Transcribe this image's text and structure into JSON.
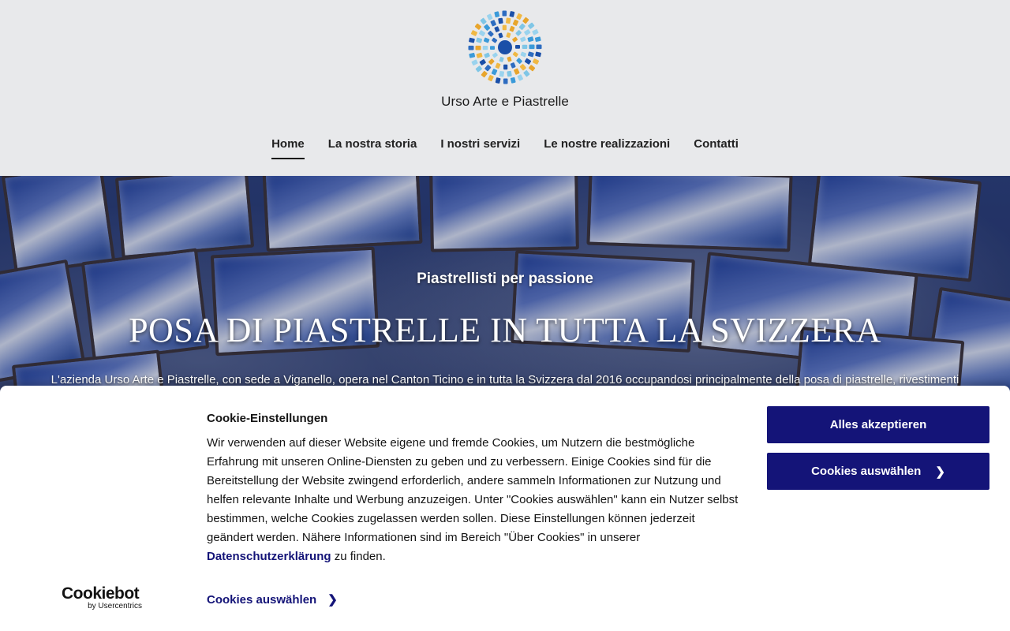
{
  "site": {
    "brand": "Urso Arte e Piastrelle"
  },
  "nav": {
    "items": [
      {
        "label": "Home",
        "active": true
      },
      {
        "label": "La nostra storia"
      },
      {
        "label": "I nostri servizi"
      },
      {
        "label": "Le nostre realizzazioni"
      },
      {
        "label": "Contatti"
      }
    ]
  },
  "hero": {
    "kicker": "Piastrellisti per passione",
    "title": "POSA DI PIASTRELLE IN TUTTA LA SVIZZERA",
    "body": "L'azienda Urso Arte e Piastrelle, con sede a Viganello, opera nel Canton Ticino e in tutta la Svizzera dal 2016 occupandosi principalmente della posa di piastrelle, rivestimenti"
  },
  "cookie_banner": {
    "logo": {
      "main": "Cookiebot",
      "sub": "by Usercentrics"
    },
    "title": "Cookie-Einstellungen",
    "text_before_link": "Wir verwenden auf dieser Website eigene und fremde Cookies, um Nutzern die bestmögliche Erfahrung mit unseren Online-Diensten zu geben und zu verbessern. Einige Cookies sind für die Bereitstellung der Website zwingend erforderlich, andere sammeln Informationen zur Nutzung und helfen relevante Inhalte und Werbung anzuzeigen. Unter \"Cookies auswählen\" kann ein Nutzer selbst bestimmen, welche Cookies zugelassen werden sollen. Diese Einstellungen können jederzeit geändert werden. Nähere Informationen sind im Bereich \"Über Cookies\" in unserer",
    "link_label": "Datenschutzerklärung",
    "text_after_link": "zu finden.",
    "select_link_label": "Cookies auswählen",
    "accept_button": "Alles akzeptieren",
    "select_button": "Cookies auswählen"
  },
  "colors": {
    "header_bg": "#e8e9eb",
    "button_bg": "#141478",
    "link": "#141478"
  }
}
